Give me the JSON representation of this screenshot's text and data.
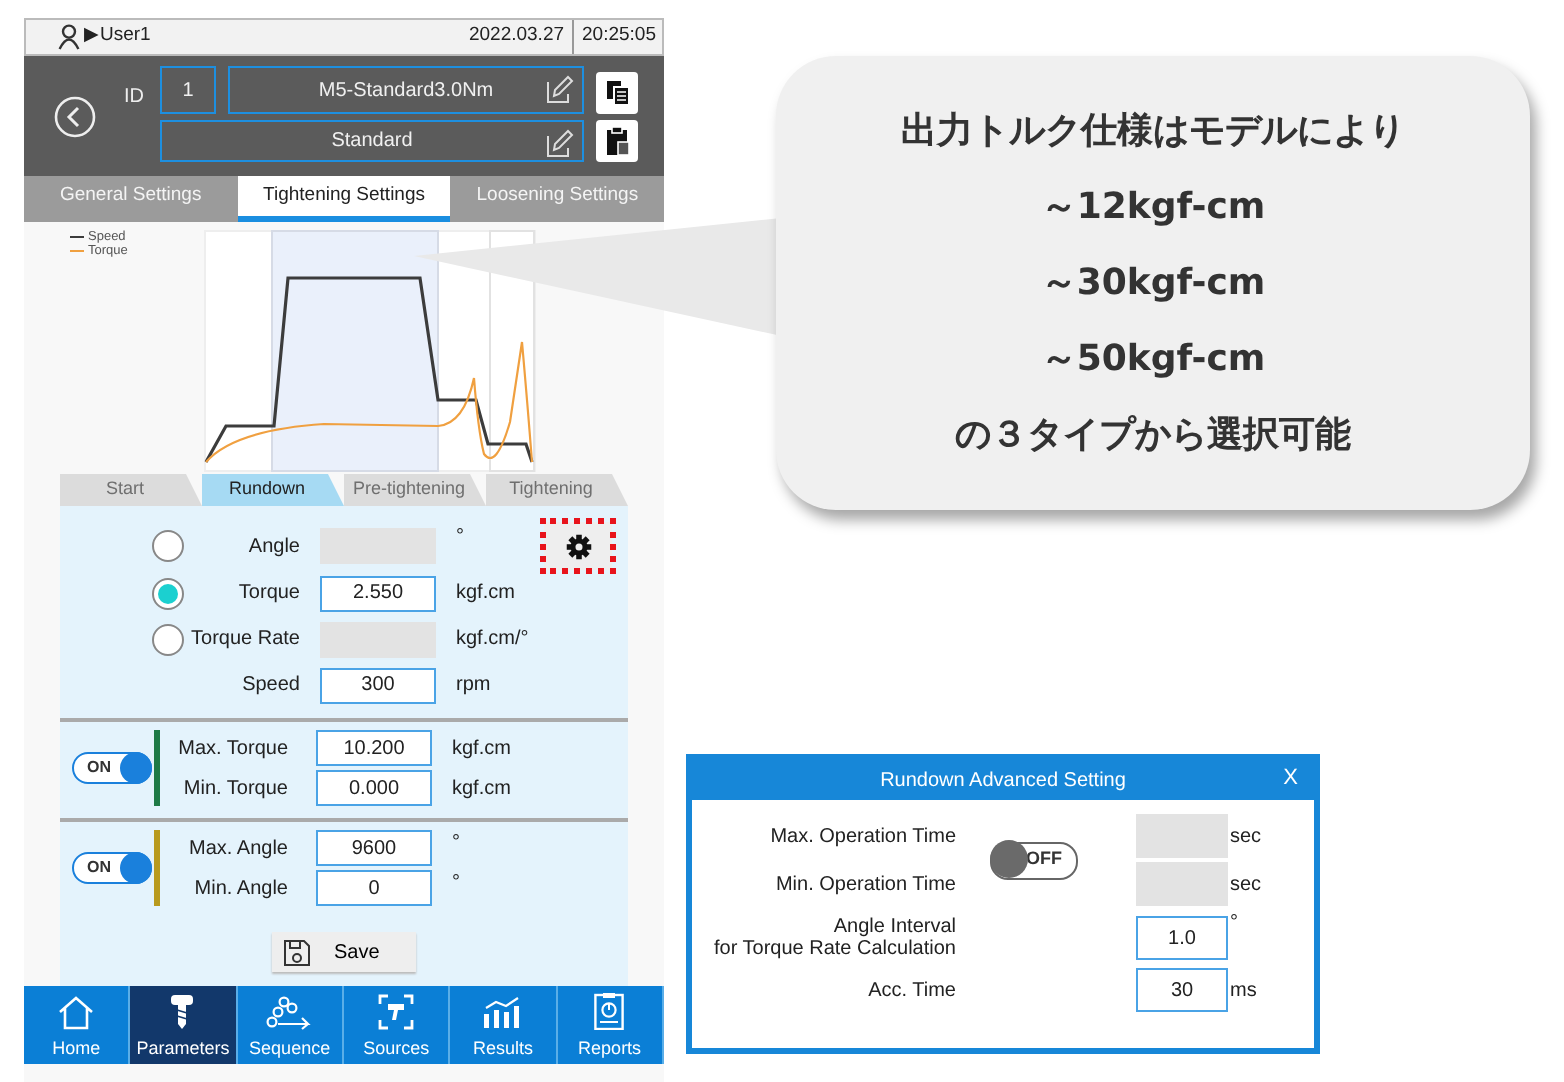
{
  "status_bar": {
    "user_marker": "▶",
    "user": "User1",
    "date": "2022.03.27",
    "time": "20:25:05"
  },
  "header": {
    "id_label": "ID",
    "id": "1",
    "program_name": "M5-Standard3.0Nm",
    "program_type": "Standard"
  },
  "tabs": [
    {
      "label": "General Settings",
      "selected": false
    },
    {
      "label": "Tightening Settings",
      "selected": true
    },
    {
      "label": "Loosening Settings",
      "selected": false
    }
  ],
  "chart": {
    "legend": [
      {
        "label": "Speed",
        "color": "#3c3c3c"
      },
      {
        "label": "Torque",
        "color": "#f0a040"
      }
    ]
  },
  "steps": [
    {
      "label": "Start",
      "selected": false
    },
    {
      "label": "Rundown",
      "selected": true
    },
    {
      "label": "Pre-tightening",
      "selected": false
    },
    {
      "label": "Tightening",
      "selected": false
    }
  ],
  "target": {
    "settings_button": {
      "highlighted": true
    },
    "rows": [
      {
        "kind": "radio",
        "label": "Angle",
        "selected": false,
        "disabled": true,
        "unit": "°"
      },
      {
        "kind": "radio",
        "label": "Torque",
        "selected": true,
        "disabled": false,
        "value": "2.550",
        "unit": "kgf.cm"
      },
      {
        "kind": "radio",
        "label": "Torque Rate",
        "selected": false,
        "disabled": true,
        "unit": "kgf.cm/°"
      },
      {
        "kind": "field",
        "label": "Speed",
        "disabled": false,
        "value": "300",
        "unit": "rpm"
      }
    ]
  },
  "limits": [
    {
      "toggle": {
        "label": "ON",
        "on": true
      },
      "color": "#1e7a46",
      "rows": [
        {
          "label": "Max. Torque",
          "value": "10.200",
          "unit": "kgf.cm"
        },
        {
          "label": "Min. Torque",
          "value": "0.000",
          "unit": "kgf.cm"
        }
      ]
    },
    {
      "toggle": {
        "label": "ON",
        "on": true
      },
      "color": "#b89a1e",
      "rows": [
        {
          "label": "Max. Angle",
          "value": "9600",
          "unit": "°"
        },
        {
          "label": "Min. Angle",
          "value": "0",
          "unit": "°"
        }
      ]
    }
  ],
  "save_button": "Save",
  "nav": [
    {
      "label": "Home",
      "selected": false
    },
    {
      "label": "Parameters",
      "selected": true
    },
    {
      "label": "Sequence",
      "selected": false
    },
    {
      "label": "Sources",
      "selected": false
    },
    {
      "label": "Results",
      "selected": false
    },
    {
      "label": "Reports",
      "selected": false
    }
  ],
  "callout": {
    "lines": [
      "出力トルク仕様はモデルにより",
      "～12kgf-cm",
      "～30kgf-cm",
      "～50kgf-cm",
      "の３タイプから選択可能"
    ]
  },
  "dialog": {
    "title": "Rundown Advanced Setting",
    "close": "X",
    "toggle": {
      "label": "OFF",
      "on": false
    },
    "rows": [
      {
        "label": "Max. Operation Time",
        "disabled": true,
        "unit": "sec"
      },
      {
        "label": "Min. Operation Time",
        "disabled": true,
        "unit": "sec"
      },
      {
        "label": "Angle Interval\nfor Torque Rate Calculation",
        "disabled": false,
        "value": "1.0",
        "unit": "°"
      },
      {
        "label": "Acc. Time",
        "disabled": false,
        "value": "30",
        "unit": "ms"
      }
    ]
  }
}
